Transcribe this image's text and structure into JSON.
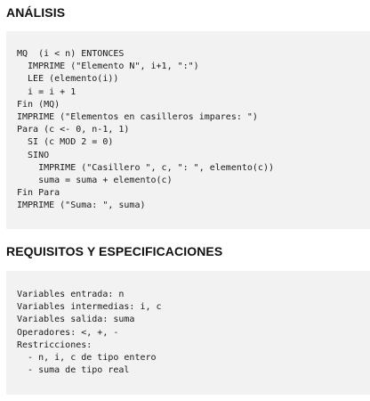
{
  "sections": [
    {
      "heading": "ANÁLISIS",
      "lines": [
        "MQ  (i < n) ENTONCES",
        "  IMPRIME (\"Elemento N\", i+1, \":\")",
        "  LEE (elemento(i))",
        "  i = i + 1",
        "Fin (MQ)",
        "IMPRIME (\"Elementos en casilleros impares: \")",
        "Para (c <- 0, n-1, 1)",
        "  SI (c MOD 2 = 0)",
        "  SINO",
        "    IMPRIME (\"Casillero \", c, \": \", elemento(c))",
        "    suma = suma + elemento(c)",
        "Fin Para",
        "IMPRIME (\"Suma: \", suma)"
      ]
    },
    {
      "heading": "REQUISITOS Y ESPECIFICACIONES",
      "lines": [
        "Variables entrada: n",
        "Variables intermedias: i, c",
        "Variables salida: suma",
        "Operadores: <, +, -",
        "Restricciones:",
        "  - n, i, c de tipo entero",
        "  - suma de tipo real"
      ]
    }
  ]
}
